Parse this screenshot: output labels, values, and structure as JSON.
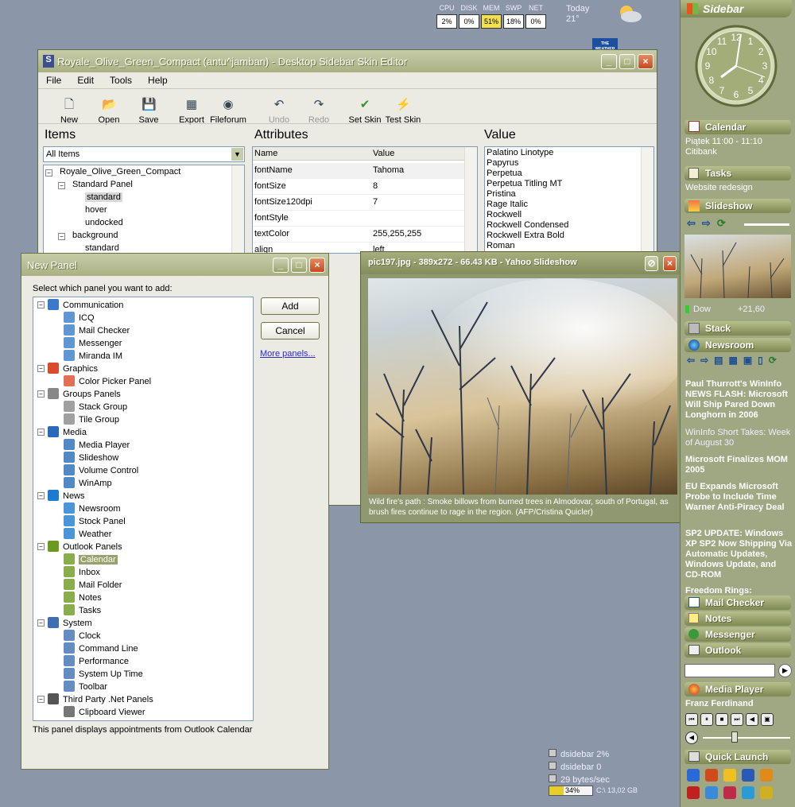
{
  "meters": {
    "labels": [
      "CPU",
      "DISK",
      "MEM",
      "SWP",
      "NET"
    ],
    "values": [
      "2%",
      "0%",
      "51%",
      "18%",
      "0%"
    ]
  },
  "weather": {
    "day": "Today",
    "temp": "21°",
    "logo": "THE WEATHER CHANNEL"
  },
  "editor": {
    "title": "Royale_Olive_Green_Compact (antu^jamban) - Desktop Sidebar Skin Editor",
    "menu": [
      "File",
      "Edit",
      "Tools",
      "Help"
    ],
    "toolbar": [
      {
        "label": "New",
        "icon": "new-icon"
      },
      {
        "label": "Open",
        "icon": "open-icon"
      },
      {
        "label": "Save",
        "icon": "save-icon"
      },
      {
        "label": "Export",
        "icon": "export-icon"
      },
      {
        "label": "Fileforum",
        "icon": "globe-icon"
      },
      {
        "label": "Undo",
        "icon": "undo-icon"
      },
      {
        "label": "Redo",
        "icon": "redo-icon"
      },
      {
        "label": "Set Skin",
        "icon": "check-icon"
      },
      {
        "label": "Test Skin",
        "icon": "lightning-icon"
      }
    ],
    "items_heading": "Items",
    "attributes_heading": "Attributes",
    "value_heading": "Value",
    "items_filter": "All Items",
    "items_tree": [
      "Royale_Olive_Green_Compact",
      "Standard Panel",
      "standard",
      "hover",
      "undocked",
      "background",
      "standard"
    ],
    "attr_cols": [
      "Name",
      "Value"
    ],
    "attributes": [
      [
        "fontName",
        "Tahoma"
      ],
      [
        "fontSize",
        "8"
      ],
      [
        "fontSize120dpi",
        "7"
      ],
      [
        "fontStyle",
        ""
      ],
      [
        "textColor",
        "255,255,255"
      ],
      [
        "align",
        "left"
      ]
    ],
    "values": [
      "Palatino Linotype",
      "Papyrus",
      "Perpetua",
      "Perpetua Titling MT",
      "Pristina",
      "Rage Italic",
      "Rockwell",
      "Rockwell Condensed",
      "Rockwell Extra Bold",
      "Roman"
    ]
  },
  "new_panel": {
    "title": "New Panel",
    "prompt": "Select which panel you want to add:",
    "add": "Add",
    "cancel": "Cancel",
    "more": "More panels...",
    "tree": [
      {
        "label": "Communication",
        "children": [
          "ICQ",
          "Mail Checker",
          "Messenger",
          "Miranda IM"
        ]
      },
      {
        "label": "Graphics",
        "children": [
          "Color Picker Panel"
        ]
      },
      {
        "label": "Groups Panels",
        "children": [
          "Stack Group",
          "Tile Group"
        ]
      },
      {
        "label": "Media",
        "children": [
          "Media Player",
          "Slideshow",
          "Volume Control",
          "WinAmp"
        ]
      },
      {
        "label": "News",
        "children": [
          "Newsroom",
          "Stock Panel",
          "Weather"
        ]
      },
      {
        "label": "Outlook Panels",
        "children": [
          "Calendar",
          "Inbox",
          "Mail Folder",
          "Notes",
          "Tasks"
        ]
      },
      {
        "label": "System",
        "children": [
          "Clock",
          "Command Line",
          "Performance",
          "System Up Time",
          "Toolbar"
        ]
      },
      {
        "label": "Third Party .Net Panels",
        "children": [
          "Clipboard Viewer"
        ]
      }
    ],
    "selected": "Calendar",
    "description": "This panel displays appointments from Outlook Calendar"
  },
  "slideshow": {
    "title": "pic197.jpg - 389x272 - 66.43 KB - Yahoo Slideshow",
    "caption": "Wild fire's path : Smoke billows from burned trees in Almodovar, south of Portugal, as brush fires continue to rage in the region. (AFP/Cristina Quicler)"
  },
  "sidebar": {
    "title": "Sidebar",
    "clock_numbers": [
      "12",
      "1",
      "2",
      "3",
      "4",
      "5",
      "6",
      "7",
      "8",
      "9",
      "10",
      "11"
    ],
    "calendar": {
      "label": "Calendar",
      "event_time": "Piątek 11:00 - 11:10",
      "event_place": "Citibank"
    },
    "tasks": {
      "label": "Tasks",
      "item": "Website redesign"
    },
    "slideshow": {
      "label": "Slideshow"
    },
    "stock": {
      "name": "Dow",
      "value": "+21,60"
    },
    "stack": {
      "label": "Stack"
    },
    "newsroom": {
      "label": "Newsroom",
      "items": [
        {
          "text": "Paul Thurrott's WinInfo NEWS FLASH: Microsoft Will Ship Pared Down Longhorn in 2006",
          "bold": true
        },
        {
          "text": "WinInfo Short Takes: Week of August 30",
          "bold": false
        },
        {
          "text": "Microsoft Finalizes MOM 2005",
          "bold": true
        },
        {
          "text": "EU Expands Microsoft Probe to Include Time Warner Anti-Piracy Deal",
          "bold": true
        },
        {
          "text": "SP2 UPDATE: Windows XP SP2 Now Shipping Via Automatic Updates, Windows Update, and CD-ROM",
          "bold": true
        },
        {
          "text": "Freedom Rings:",
          "bold": true
        }
      ]
    },
    "mail_checker": "Mail Checker",
    "notes": "Notes",
    "messenger": "Messenger",
    "outlook": "Outlook",
    "media_player": {
      "label": "Media Player",
      "track": "Franz Ferdinand",
      "volume": 0.35
    },
    "quick_launch": "Quick Launch"
  },
  "tray": {
    "lines": [
      "dsidebar 2%",
      "dsidebar 0",
      "29 bytes/sec"
    ],
    "disk_percent": "34%",
    "disk_value": 0.34,
    "disk_label": "C:\\ 13,02 GB"
  },
  "colors": {
    "olive": "#9fa882",
    "olive_dark": "#7e8852",
    "desktop": "#8b97a8",
    "select": "#9aa16e"
  }
}
